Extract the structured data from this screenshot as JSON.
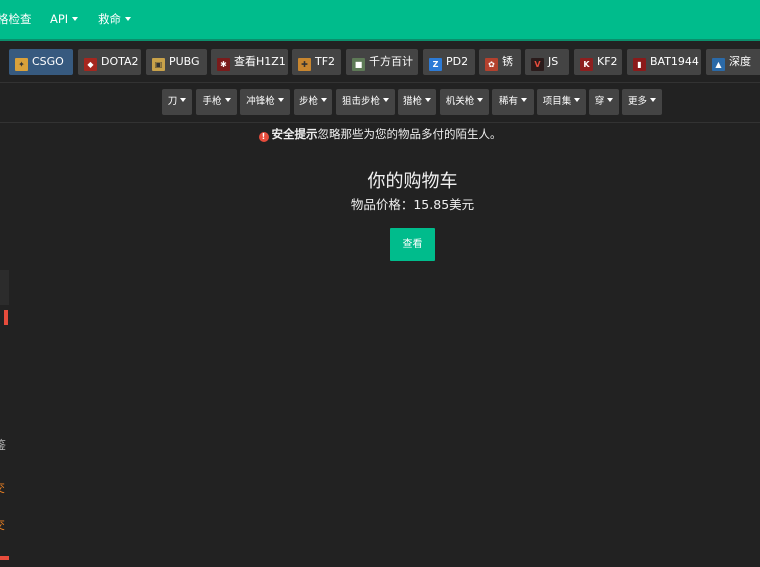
{
  "topnav": {
    "items": [
      {
        "label": "格检查",
        "caret": false
      },
      {
        "label": "API",
        "caret": true
      },
      {
        "label": "救命",
        "caret": true
      }
    ]
  },
  "games": [
    {
      "label": "CSGO",
      "icon": "csgo-icon",
      "active": true
    },
    {
      "label": "DOTA2",
      "icon": "dota2-icon"
    },
    {
      "label": "PUBG",
      "icon": "pubg-icon"
    },
    {
      "label": "查看H1Z1",
      "icon": "h1z1-icon"
    },
    {
      "label": "TF2",
      "icon": "tf2-icon"
    },
    {
      "label": "千方百计",
      "icon": "unturned-icon"
    },
    {
      "label": "PD2",
      "icon": "pd2-icon"
    },
    {
      "label": "锈",
      "icon": "rust-icon"
    },
    {
      "label": "JS",
      "icon": "js-icon"
    },
    {
      "label": "KF2",
      "icon": "kf2-icon"
    },
    {
      "label": "BAT1944",
      "icon": "bat1944-icon"
    },
    {
      "label": "深度",
      "icon": "depth-icon"
    }
  ],
  "categories": [
    "刀",
    "手枪",
    "冲锋枪",
    "步枪",
    "狙击步枪",
    "猎枪",
    "机关枪",
    "稀有",
    "项目集",
    "穿",
    "更多"
  ],
  "notice": {
    "strong": "安全提示",
    "text": "忽略那些为您的物品多付的陌生人。"
  },
  "cart": {
    "title": "你的购物车",
    "price_label": "物品价格：",
    "price_value": "15.85美元",
    "button": "查看"
  },
  "left_edge": [
    "鉴",
    "交",
    "交"
  ],
  "colors": {
    "accent": "#00bc8c",
    "background": "#222222",
    "button": "#444444",
    "active": "#375a7f",
    "danger": "#e74c3c"
  }
}
